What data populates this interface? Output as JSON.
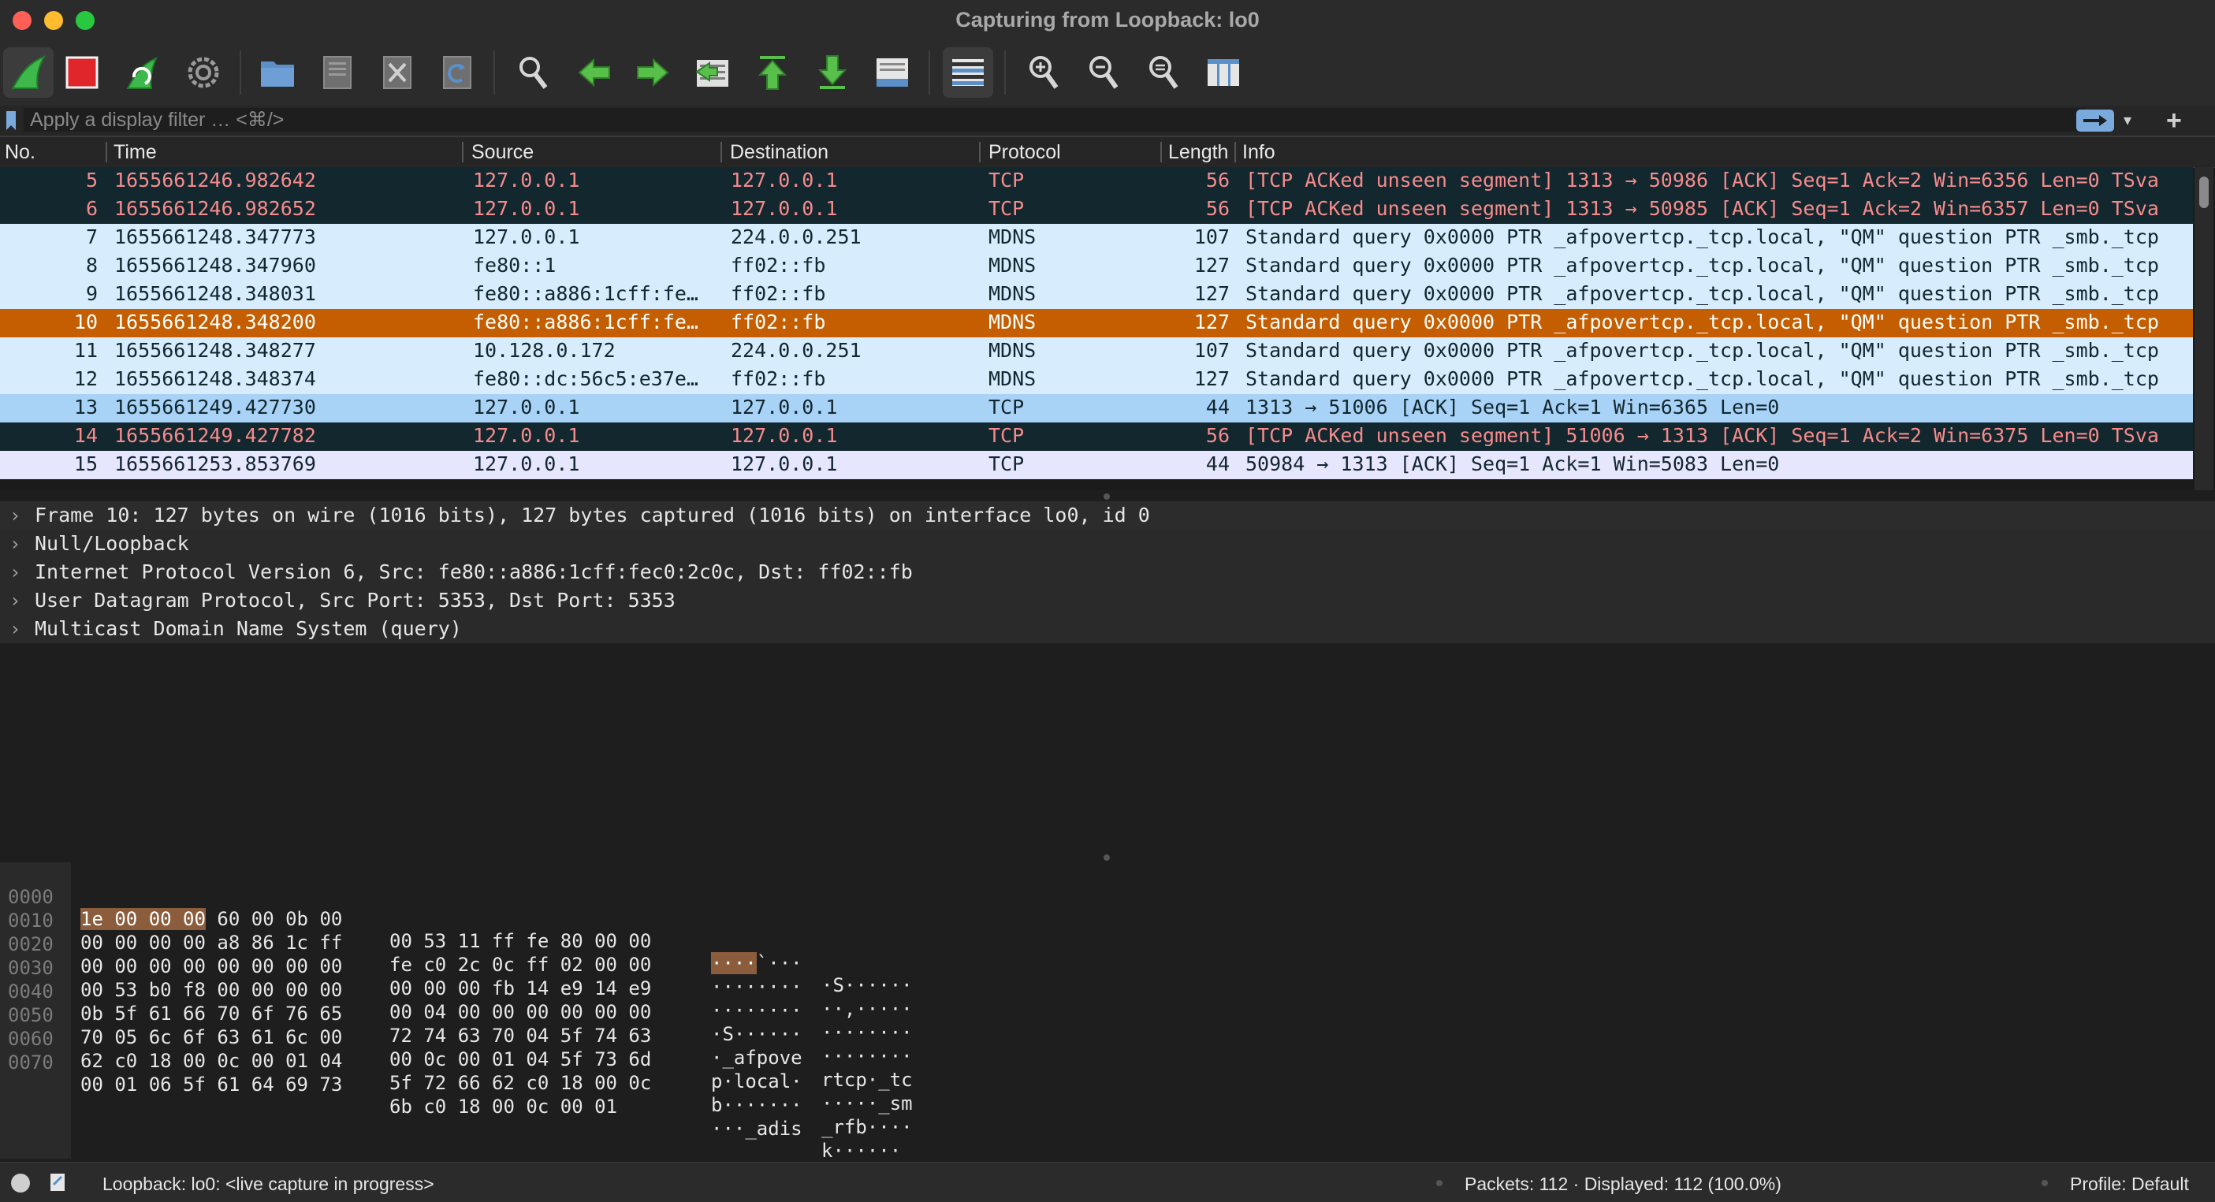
{
  "window": {
    "title": "Capturing from Loopback: lo0"
  },
  "toolbar": {
    "buttons": [
      {
        "icon": "shark-fin-icon",
        "label": "Start capture"
      },
      {
        "icon": "stop-square-icon",
        "label": "Stop capture"
      },
      {
        "icon": "restart-fin-icon",
        "label": "Restart capture"
      },
      {
        "icon": "gear-icon",
        "label": "Capture options"
      },
      {
        "icon": "folder-icon",
        "label": "Open"
      },
      {
        "icon": "save-file-icon",
        "label": "Save"
      },
      {
        "icon": "close-file-icon",
        "label": "Close"
      },
      {
        "icon": "reload-icon",
        "label": "Reload"
      },
      {
        "icon": "search-icon",
        "label": "Find packet"
      },
      {
        "icon": "arrow-left-icon",
        "label": "Go back"
      },
      {
        "icon": "arrow-right-icon",
        "label": "Go forward"
      },
      {
        "icon": "go-to-packet-icon",
        "label": "Go to packet"
      },
      {
        "icon": "arrow-up-icon",
        "label": "First packet"
      },
      {
        "icon": "arrow-down-icon",
        "label": "Last packet"
      },
      {
        "icon": "autoscroll-icon",
        "label": "Auto scroll"
      },
      {
        "icon": "colorize-icon",
        "label": "Colorize"
      },
      {
        "icon": "zoom-in-icon",
        "label": "Zoom in"
      },
      {
        "icon": "zoom-out-icon",
        "label": "Zoom out"
      },
      {
        "icon": "zoom-normal-icon",
        "label": "Normal size"
      },
      {
        "icon": "resize-columns-icon",
        "label": "Resize columns"
      }
    ],
    "colors": {
      "green": "#3fb84b",
      "red": "#e0262b",
      "blue": "#5b8fc7",
      "gray": "#9a9a9a"
    }
  },
  "filter": {
    "placeholder": "Apply a display filter … <⌘/>",
    "value": "",
    "plus": "+"
  },
  "packet_list": {
    "columns": [
      "No.",
      "Time",
      "Source",
      "Destination",
      "Protocol",
      "Length",
      "Info"
    ],
    "rows": [
      {
        "no": "5",
        "time": "1655661246.982642",
        "src": "127.0.0.1",
        "dst": "127.0.0.1",
        "proto": "TCP",
        "len": "56",
        "info": "[TCP ACKed unseen segment] 1313 → 50986 [ACK] Seq=1 Ack=2 Win=6356 Len=0 TSva",
        "style": "err"
      },
      {
        "no": "6",
        "time": "1655661246.982652",
        "src": "127.0.0.1",
        "dst": "127.0.0.1",
        "proto": "TCP",
        "len": "56",
        "info": "[TCP ACKed unseen segment] 1313 → 50985 [ACK] Seq=1 Ack=2 Win=6357 Len=0 TSva",
        "style": "err"
      },
      {
        "no": "7",
        "time": "1655661248.347773",
        "src": "127.0.0.1",
        "dst": "224.0.0.251",
        "proto": "MDNS",
        "len": "107",
        "info": "Standard query 0x0000 PTR _afpovertcp._tcp.local, \"QM\" question PTR _smb._tcp",
        "style": "mdns"
      },
      {
        "no": "8",
        "time": "1655661248.347960",
        "src": "fe80::1",
        "dst": "ff02::fb",
        "proto": "MDNS",
        "len": "127",
        "info": "Standard query 0x0000 PTR _afpovertcp._tcp.local, \"QM\" question PTR _smb._tcp",
        "style": "mdns"
      },
      {
        "no": "9",
        "time": "1655661248.348031",
        "src": "fe80::a886:1cff:fe…",
        "dst": "ff02::fb",
        "proto": "MDNS",
        "len": "127",
        "info": "Standard query 0x0000 PTR _afpovertcp._tcp.local, \"QM\" question PTR _smb._tcp",
        "style": "mdns"
      },
      {
        "no": "10",
        "time": "1655661248.348200",
        "src": "fe80::a886:1cff:fe…",
        "dst": "ff02::fb",
        "proto": "MDNS",
        "len": "127",
        "info": "Standard query 0x0000 PTR _afpovertcp._tcp.local, \"QM\" question PTR _smb._tcp",
        "style": "sel"
      },
      {
        "no": "11",
        "time": "1655661248.348277",
        "src": "10.128.0.172",
        "dst": "224.0.0.251",
        "proto": "MDNS",
        "len": "107",
        "info": "Standard query 0x0000 PTR _afpovertcp._tcp.local, \"QM\" question PTR _smb._tcp",
        "style": "mdns"
      },
      {
        "no": "12",
        "time": "1655661248.348374",
        "src": "fe80::dc:56c5:e37e…",
        "dst": "ff02::fb",
        "proto": "MDNS",
        "len": "127",
        "info": "Standard query 0x0000 PTR _afpovertcp._tcp.local, \"QM\" question PTR _smb._tcp",
        "style": "mdns"
      },
      {
        "no": "13",
        "time": "1655661249.427730",
        "src": "127.0.0.1",
        "dst": "127.0.0.1",
        "proto": "TCP",
        "len": "44",
        "info": "1313 → 51006 [ACK] Seq=1 Ack=1 Win=6365 Len=0",
        "style": "tcp2"
      },
      {
        "no": "14",
        "time": "1655661249.427782",
        "src": "127.0.0.1",
        "dst": "127.0.0.1",
        "proto": "TCP",
        "len": "56",
        "info": "[TCP ACKed unseen segment] 51006 → 1313 [ACK] Seq=1 Ack=2 Win=6375 Len=0 TSva",
        "style": "err"
      },
      {
        "no": "15",
        "time": "1655661253.853769",
        "src": "127.0.0.1",
        "dst": "127.0.0.1",
        "proto": "TCP",
        "len": "44",
        "info": "50984 → 1313 [ACK] Seq=1 Ack=1 Win=5083 Len=0",
        "style": "tcp"
      }
    ]
  },
  "details": [
    "Frame 10: 127 bytes on wire (1016 bits), 127 bytes captured (1016 bits) on interface lo0, id 0",
    "Null/Loopback",
    "Internet Protocol Version 6, Src: fe80::a886:1cff:fec0:2c0c, Dst: ff02::fb",
    "User Datagram Protocol, Src Port: 5353, Dst Port: 5353",
    "Multicast Domain Name System (query)"
  ],
  "bytes": [
    {
      "off": "0000",
      "hex_hl": "1e 00 00 00",
      "hex1": " 60 00 0b 00",
      "hex2": "00 53 11 ff fe 80 00 00",
      "asc_hl": "····",
      "asc1": "`···",
      "asc2": "·S······"
    },
    {
      "off": "0010",
      "hex_hl": "",
      "hex1": "00 00 00 00 a8 86 1c ff",
      "hex2": "fe c0 2c 0c ff 02 00 00",
      "asc_hl": "",
      "asc1": "········",
      "asc2": "··,·····"
    },
    {
      "off": "0020",
      "hex_hl": "",
      "hex1": "00 00 00 00 00 00 00 00",
      "hex2": "00 00 00 fb 14 e9 14 e9",
      "asc_hl": "",
      "asc1": "········",
      "asc2": "········"
    },
    {
      "off": "0030",
      "hex_hl": "",
      "hex1": "00 53 b0 f8 00 00 00 00",
      "hex2": "00 04 00 00 00 00 00 00",
      "asc_hl": "",
      "asc1": "·S······",
      "asc2": "········"
    },
    {
      "off": "0040",
      "hex_hl": "",
      "hex1": "0b 5f 61 66 70 6f 76 65",
      "hex2": "72 74 63 70 04 5f 74 63",
      "asc_hl": "",
      "asc1": "·_afpove",
      "asc2": "rtcp·_tc"
    },
    {
      "off": "0050",
      "hex_hl": "",
      "hex1": "70 05 6c 6f 63 61 6c 00",
      "hex2": "00 0c 00 01 04 5f 73 6d",
      "asc_hl": "",
      "asc1": "p·local·",
      "asc2": "·····_sm"
    },
    {
      "off": "0060",
      "hex_hl": "",
      "hex1": "62 c0 18 00 0c 00 01 04",
      "hex2": "5f 72 66 62 c0 18 00 0c",
      "asc_hl": "",
      "asc1": "b·······",
      "asc2": "_rfb····"
    },
    {
      "off": "0070",
      "hex_hl": "",
      "hex1": "00 01 06 5f 61 64 69 73",
      "hex2": "6b c0 18 00 0c 00 01",
      "asc_hl": "",
      "asc1": "···_adis",
      "asc2": "k······"
    }
  ],
  "status": {
    "capture": "Loopback: lo0: <live capture in progress>",
    "packets": "Packets: 112 · Displayed: 112 (100.0%)",
    "profile": "Profile: Default"
  }
}
